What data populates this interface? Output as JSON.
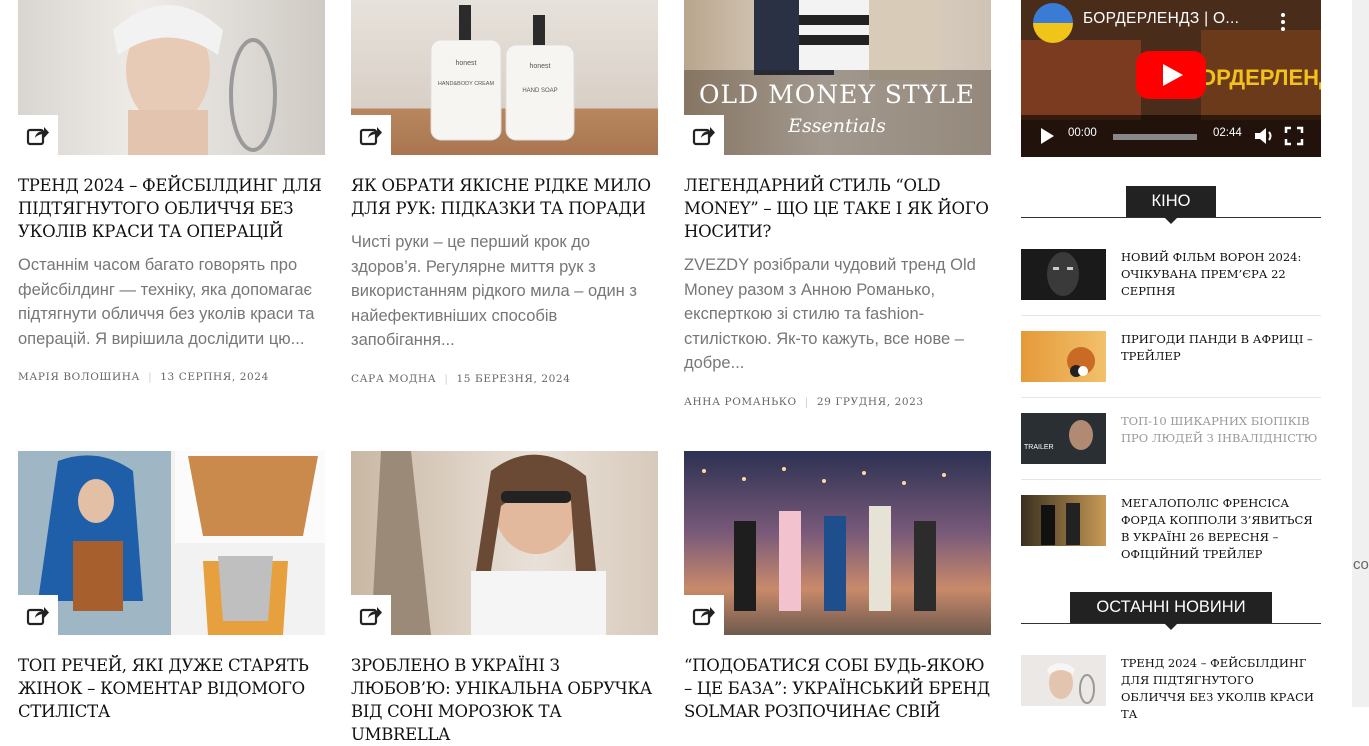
{
  "articles": [
    {
      "title": "Тренд 2024 – фейсбілдинг для підтягнутого обличчя без уколів краси та операцій",
      "excerpt": "Останнім часом багато говорять про фейсбілдинг — техніку, яка допомагає підтягнути обличчя без уколів краси та операцій. Я вирішила дослідити цю...",
      "author": "Марія Волошина",
      "date": "13 серпня, 2024"
    },
    {
      "title": "Як обрати якісне рідке мило для рук: підказки та поради",
      "excerpt": "Чисті руки – це перший крок до здоров’я. Регулярне миття рук з використанням рідкого мила – один з найефективніших способів запобігання...",
      "author": "Сара Модна",
      "date": "15 березня, 2024"
    },
    {
      "title": "Легендарний стиль “Old Money” – що це таке і як його носити?",
      "excerpt": "ZVEZDY розібрали чудовий тренд Old Money разом з Анною Романько, експерткою зі стилю та fashion-стилісткою. Як-то кажуть, все нове – добре...",
      "author": "Анна Романько",
      "date": "29 грудня, 2023",
      "image_text": {
        "line1": "OLD MONEY STYLE",
        "line2": "Essentials"
      }
    },
    {
      "title": "Топ речей, які дуже старять жінок – коментар відомого стиліста"
    },
    {
      "title": "Зроблено в Україні з любов’ю: унікальна обручка від Соні Морозюк та Umbrella"
    },
    {
      "title": "“Подобатися собі будь-якою – це база”: український бренд Solmar розпочинає свій"
    }
  ],
  "product_labels": {
    "bottle1": "honest",
    "bottle1_sub": "HAND&BODY CREAM",
    "bottle2": "honest",
    "bottle2_sub": "HAND SOAP"
  },
  "video": {
    "title": "БОРДЕРЛЕНДЗ | О...",
    "overlay_text": "БОРДЕРЛЕНДЗ",
    "current_time": "00:00",
    "duration": "02:44"
  },
  "sections": {
    "kino": "КІНО",
    "latest": "ОСТАННІ НОВИНИ"
  },
  "kino_items": [
    {
      "title": "Новий фільм Ворон 2024: очікувана прем’єра 22 серпня"
    },
    {
      "title": "Пригоди Панди в Африці – трейлер"
    },
    {
      "title": "Топ-10 шикарних біопіків про людей з інвалідністю",
      "badge": "TRAILER"
    },
    {
      "title": "Мегалополіс Френсіса Форда Копполи з’явиться в Україні 26 вересня – офіційний трейлер"
    }
  ],
  "latest_items": [
    {
      "title": "Тренд 2024 – фейсбілдинг для підтягнутого обличчя без уколів краси та"
    }
  ],
  "edge_text": "co",
  "icons": {
    "share": "share-icon",
    "play": "play-icon",
    "volume": "volume-icon",
    "fullscreen": "fullscreen-icon",
    "more": "kebab-icon"
  }
}
